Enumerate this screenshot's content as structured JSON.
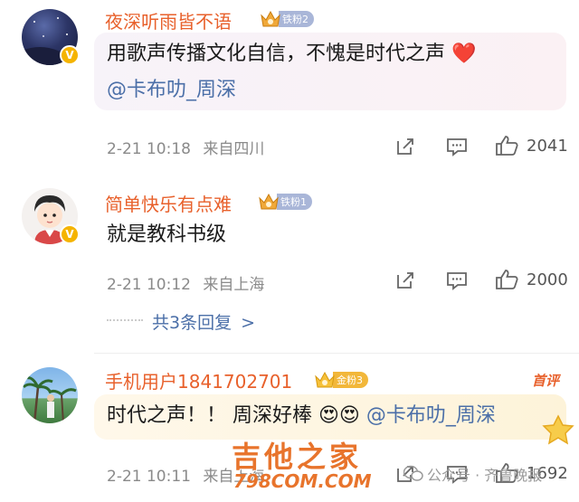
{
  "comments": [
    {
      "username": "夜深听雨皆不语",
      "fan_badge": "铁粉2",
      "line1": "用歌声传播文化自信，不愧是时代之声",
      "heart": "❤️",
      "line2": "@卡布叻_周深",
      "time": "2-21 10:18",
      "location": "来自四川",
      "likes": "2041"
    },
    {
      "username": "简单快乐有点难",
      "fan_badge": "铁粉1",
      "line1": "就是教科书级",
      "time": "2-21 10:12",
      "location": "来自上海",
      "likes": "2000",
      "replies_label": "共3条回复"
    },
    {
      "username": "手机用户1841702701",
      "fan_badge": "金粉3",
      "top_label": "首评",
      "line1": "时代之声！！ 周深好棒",
      "emoji": "😍😍",
      "mention": "@卡布叻_周深",
      "time": "2-21 10:11",
      "location": "来自上海",
      "likes": "1692"
    }
  ],
  "watermark": {
    "site_name": "吉他之家",
    "site_url": "798COM.COM",
    "wechat_text": "公众号 · 齐鲁晚报"
  }
}
